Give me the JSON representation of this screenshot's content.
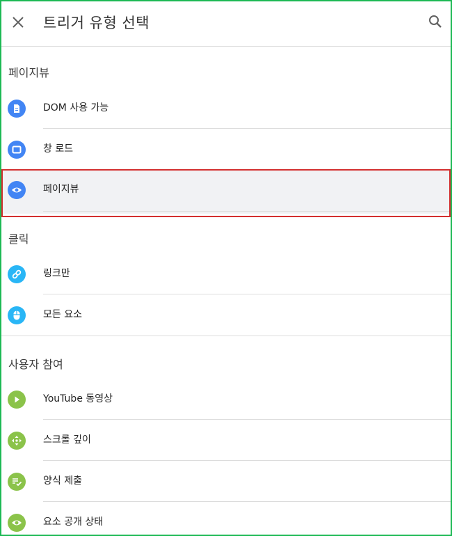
{
  "header": {
    "title": "트리거 유형 선택",
    "close_icon": "close-icon",
    "search_icon": "search-icon"
  },
  "sections": [
    {
      "title": "페이지뷰",
      "items": [
        {
          "label": "DOM 사용 가능",
          "icon": "document-icon",
          "color": "#4285f4"
        },
        {
          "label": "창 로드",
          "icon": "window-icon",
          "color": "#4285f4"
        },
        {
          "label": "페이지뷰",
          "icon": "eye-icon",
          "color": "#4285f4",
          "selected": true
        }
      ]
    },
    {
      "title": "클릭",
      "items": [
        {
          "label": "링크만",
          "icon": "link-icon",
          "color": "#29b6f6"
        },
        {
          "label": "모든 요소",
          "icon": "mouse-icon",
          "color": "#29b6f6"
        }
      ]
    },
    {
      "title": "사용자 참여",
      "items": [
        {
          "label": "YouTube 동영상",
          "icon": "play-icon",
          "color": "#8bc34a"
        },
        {
          "label": "스크롤 깊이",
          "icon": "scroll-arrows-icon",
          "color": "#8bc34a"
        },
        {
          "label": "양식 제출",
          "icon": "form-check-icon",
          "color": "#8bc34a"
        },
        {
          "label": "요소 공개 상태",
          "icon": "eye-icon",
          "color": "#8bc34a"
        }
      ]
    }
  ]
}
